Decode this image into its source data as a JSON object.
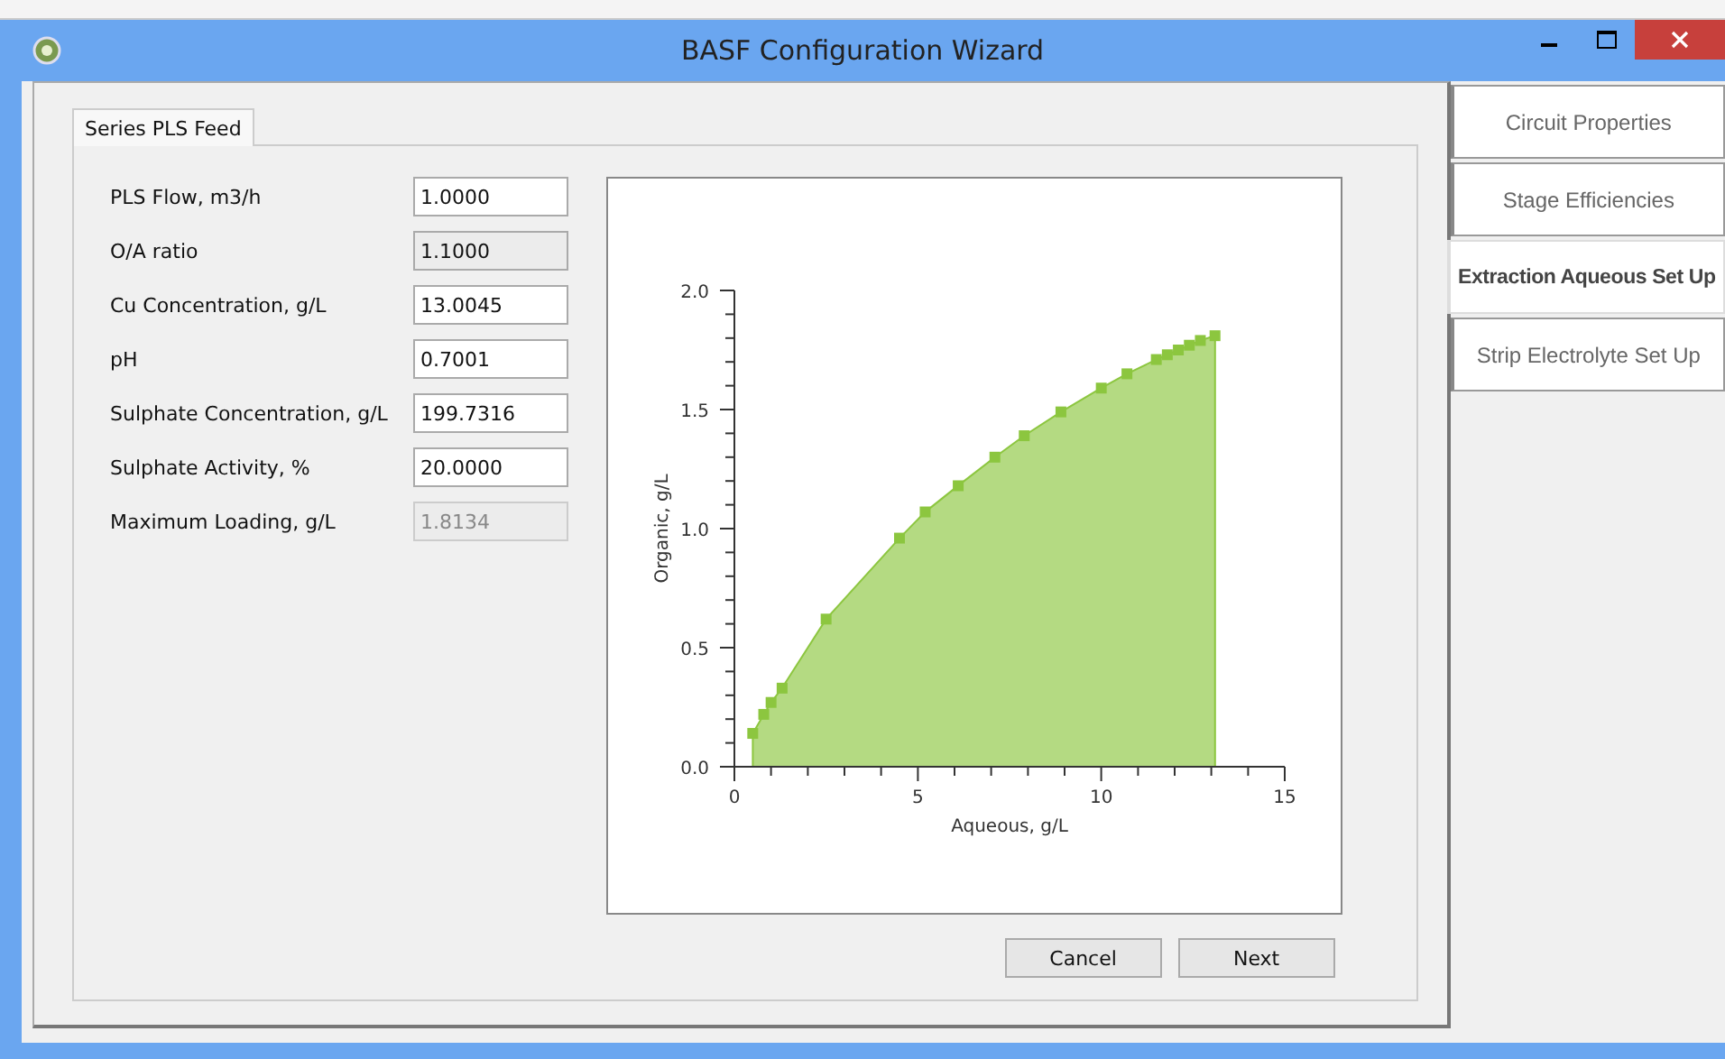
{
  "window": {
    "title": "BASF Configuration Wizard"
  },
  "tabs": [
    {
      "label": "Series PLS Feed",
      "selected": true
    }
  ],
  "fields": [
    {
      "label": "PLS Flow, m3/h",
      "value": "1.0000",
      "kind": "input"
    },
    {
      "label": "O/A ratio",
      "value": "1.1000",
      "kind": "readonly"
    },
    {
      "label": "Cu Concentration, g/L",
      "value": "13.0045",
      "kind": "input"
    },
    {
      "label": "pH",
      "value": "0.7001",
      "kind": "input"
    },
    {
      "label": "Sulphate Concentration, g/L",
      "value": "199.7316",
      "kind": "input"
    },
    {
      "label": "Sulphate Activity, %",
      "value": "20.0000",
      "kind": "input"
    },
    {
      "label": "Maximum Loading, g/L",
      "value": "1.8134",
      "kind": "disabled"
    }
  ],
  "chart_data": {
    "type": "area",
    "xlabel": "Aqueous, g/L",
    "ylabel": "Organic, g/L",
    "x": [
      0.5,
      0.8,
      1.0,
      1.3,
      2.5,
      4.5,
      5.2,
      6.1,
      7.1,
      7.9,
      8.9,
      10.0,
      10.7,
      11.5,
      11.8,
      12.1,
      12.4,
      12.7,
      13.1
    ],
    "series": [
      {
        "color": "#8cc63f",
        "values": [
          0.14,
          0.22,
          0.27,
          0.33,
          0.62,
          0.96,
          1.07,
          1.18,
          1.3,
          1.39,
          1.49,
          1.59,
          1.65,
          1.71,
          1.73,
          1.75,
          1.77,
          1.79,
          1.81
        ]
      }
    ],
    "xlim": [
      0,
      15
    ],
    "ylim": [
      0,
      2
    ],
    "xticks": [
      0,
      5,
      10,
      15
    ],
    "yticks": [
      {
        "value": 0,
        "label": "0.0"
      },
      {
        "value": 0.5,
        "label": "0.5"
      },
      {
        "value": 1,
        "label": "1.0"
      },
      {
        "value": 1.5,
        "label": "1.5"
      },
      {
        "value": 2,
        "label": "2.0"
      }
    ]
  },
  "buttons": [
    "Cancel",
    "Next"
  ],
  "side_tabs": [
    {
      "label": "Circuit Properties",
      "selected": false
    },
    {
      "label": "Stage Efficiencies",
      "selected": false
    },
    {
      "label": "Extraction Aqueous Set Up",
      "selected": true
    },
    {
      "label": "Strip Electrolyte Set Up",
      "selected": false
    }
  ]
}
